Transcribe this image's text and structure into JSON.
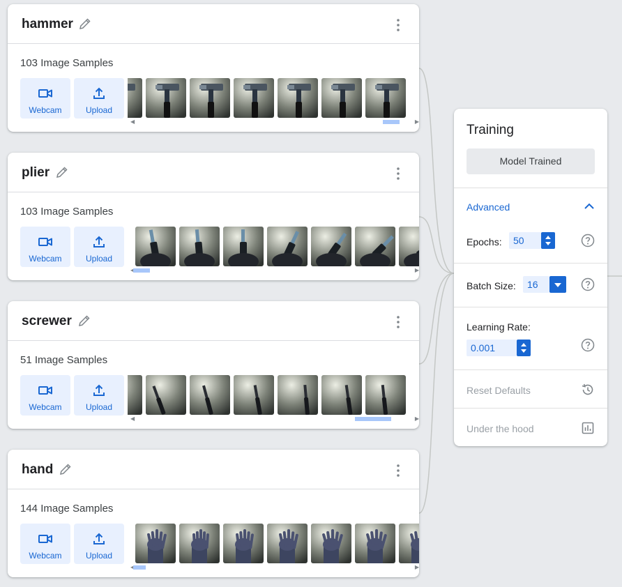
{
  "classes": [
    {
      "name": "hammer",
      "samples": "103 Image Samples",
      "webcam": "Webcam",
      "upload": "Upload",
      "subject": "hammer",
      "scroll_start": 0.89,
      "scroll_size": 0.06
    },
    {
      "name": "plier",
      "samples": "103 Image Samples",
      "webcam": "Webcam",
      "upload": "Upload",
      "subject": "plier",
      "scroll_start": 0.0,
      "scroll_size": 0.06
    },
    {
      "name": "screwer",
      "samples": "51 Image Samples",
      "webcam": "Webcam",
      "upload": "Upload",
      "subject": "screwer",
      "scroll_start": 0.79,
      "scroll_size": 0.13
    },
    {
      "name": "hand",
      "samples": "144 Image Samples",
      "webcam": "Webcam",
      "upload": "Upload",
      "subject": "hand",
      "scroll_start": 0.0,
      "scroll_size": 0.045
    }
  ],
  "icons": {
    "edit": "pencil-icon",
    "more": "more-vert-icon",
    "webcam": "videocam-icon",
    "upload": "upload-icon"
  },
  "training": {
    "title": "Training",
    "status_button": "Model Trained",
    "advanced_label": "Advanced",
    "advanced_expanded": true,
    "epochs_label": "Epochs:",
    "epochs_value": "50",
    "batch_label": "Batch Size:",
    "batch_value": "16",
    "lr_label": "Learning Rate:",
    "lr_value": "0.001",
    "reset_label": "Reset Defaults",
    "hood_label": "Under the hood"
  },
  "colors": {
    "accent": "#1967d2",
    "button_bg": "#e8f0fe",
    "page_bg": "#e8eaed",
    "scroll_thumb": "#a8c7fa"
  }
}
